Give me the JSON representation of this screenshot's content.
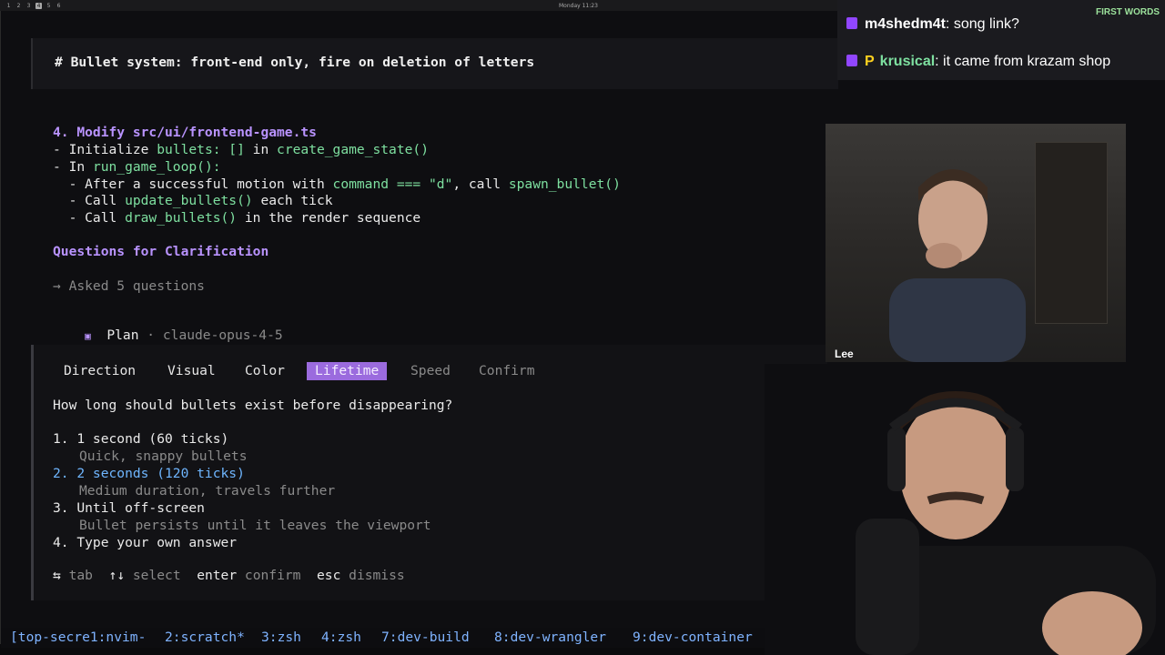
{
  "topbar": {
    "workspaces": [
      "1",
      "2",
      "3",
      "4",
      "5",
      "6"
    ],
    "active_workspace": 4,
    "clock": "Monday 11:23"
  },
  "header": {
    "text": "# Bullet system: front-end only, fire on deletion of letters"
  },
  "plan": {
    "step_title": "4. Modify src/ui/frontend-game.ts",
    "lines": [
      {
        "prefix": "- Initialize ",
        "code": "bullets: []",
        "mid": " in ",
        "code2": "create_game_state()",
        "suffix": ""
      },
      {
        "prefix": "- In ",
        "code": "run_game_loop():",
        "mid": "",
        "code2": "",
        "suffix": ""
      },
      {
        "prefix": "  - After a successful motion with ",
        "code": "command === \"d\"",
        "mid": ", call ",
        "code2": "spawn_bullet()",
        "suffix": ""
      },
      {
        "prefix": "  - Call ",
        "code": "update_bullets()",
        "mid": " each tick",
        "code2": "",
        "suffix": ""
      },
      {
        "prefix": "  - Call ",
        "code": "draw_bullets()",
        "mid": " in the render sequence",
        "code2": "",
        "suffix": ""
      }
    ],
    "questions_heading": "Questions for Clarification",
    "asked": "→ Asked 5 questions",
    "mode_icon": "▣",
    "mode_label": "Plan",
    "mode_sep": " · ",
    "model": "claude-opus-4-5"
  },
  "question": {
    "tabs": [
      {
        "label": "Direction",
        "state": "done"
      },
      {
        "label": "Visual",
        "state": "done"
      },
      {
        "label": "Color",
        "state": "done"
      },
      {
        "label": "Lifetime",
        "state": "active"
      },
      {
        "label": "Speed",
        "state": "pending"
      },
      {
        "label": "Confirm",
        "state": "pending"
      }
    ],
    "prompt": "How long should bullets exist before disappearing?",
    "options": [
      {
        "label": "1. 1 second (60 ticks)",
        "desc": "Quick, snappy bullets"
      },
      {
        "label": "2. 2 seconds (120 ticks)",
        "desc": "Medium duration, travels further",
        "selected": true
      },
      {
        "label": "3. Until off-screen",
        "desc": "Bullet persists until it leaves the viewport"
      },
      {
        "label": "4. Type your own answer",
        "desc": ""
      }
    ],
    "hints": [
      {
        "key": "⇆",
        "text": " tab"
      },
      {
        "key": "↑↓",
        "text": " select"
      },
      {
        "key": "enter",
        "text": " confirm"
      },
      {
        "key": "esc",
        "text": " dismiss"
      }
    ]
  },
  "tmux": {
    "windows": [
      "[top-secre1:nvim-",
      "2:scratch*",
      "3:zsh",
      "4:zsh",
      "7:dev-build",
      "8:dev-wrangler",
      "9:dev-container"
    ]
  },
  "chat": {
    "first_words_label": "FIRST WORDS",
    "messages": [
      {
        "user": "m4shedm4t",
        "text": ": song link?",
        "badge": ""
      },
      {
        "user": "krusical",
        "text": ": it came from krazam shop",
        "badge": "P"
      }
    ]
  },
  "webcam": {
    "label": "Lee"
  },
  "colors": {
    "accent_purple": "#9b6bde",
    "code_green": "#7ee0a0",
    "selected_blue": "#6fb6ff",
    "heading_purple": "#b993ff"
  }
}
